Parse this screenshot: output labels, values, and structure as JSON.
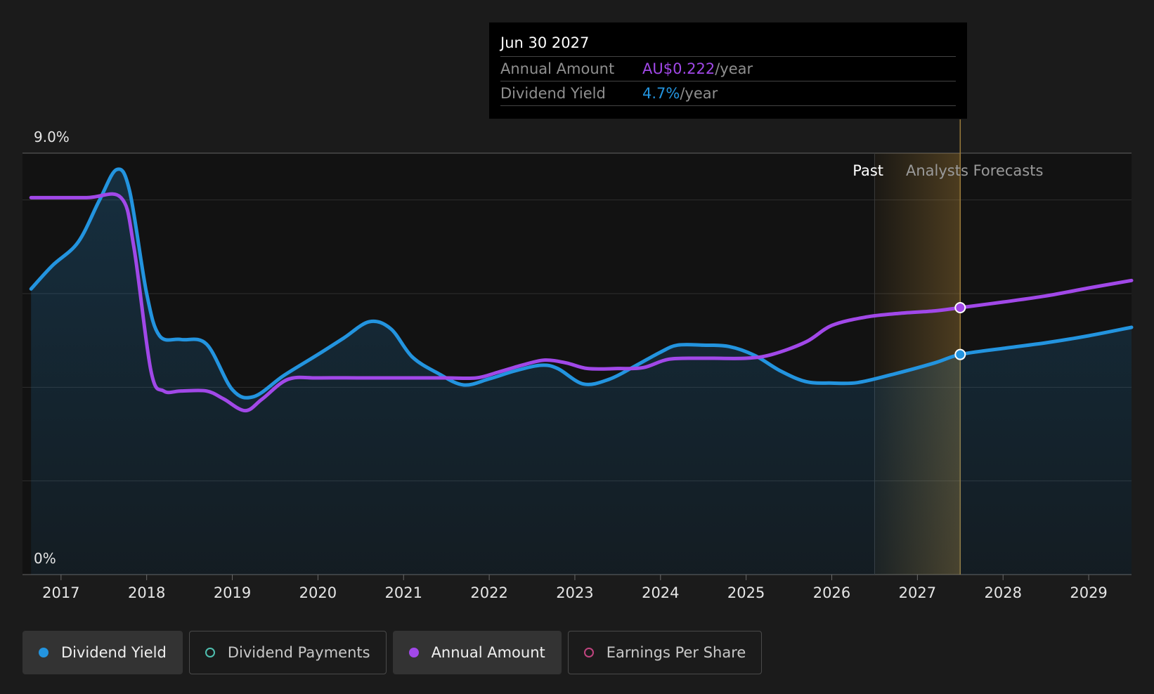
{
  "chart_data": {
    "type": "line",
    "y_tick_labels": {
      "top": "9.0%",
      "bottom": "0%"
    },
    "ylim": [
      0,
      9.0
    ],
    "xlim": [
      2016.55,
      2029.5
    ],
    "x_ticks": [
      "2017",
      "2018",
      "2019",
      "2020",
      "2021",
      "2022",
      "2023",
      "2024",
      "2025",
      "2026",
      "2027",
      "2028",
      "2029"
    ],
    "grid": true,
    "past_label": "Past",
    "forecast_label": "Analysts Forecasts",
    "forecast_start": 2026.5,
    "series": [
      {
        "name": "Dividend Yield",
        "color": "#2394df",
        "area": true,
        "points": [
          [
            2016.65,
            6.1
          ],
          [
            2016.9,
            6.6
          ],
          [
            2017.2,
            7.1
          ],
          [
            2017.45,
            8.0
          ],
          [
            2017.65,
            8.65
          ],
          [
            2017.8,
            8.2
          ],
          [
            2018.0,
            6.0
          ],
          [
            2018.15,
            5.1
          ],
          [
            2018.4,
            5.02
          ],
          [
            2018.7,
            4.92
          ],
          [
            2019.0,
            3.95
          ],
          [
            2019.25,
            3.8
          ],
          [
            2019.6,
            4.25
          ],
          [
            2020.0,
            4.7
          ],
          [
            2020.3,
            5.05
          ],
          [
            2020.6,
            5.4
          ],
          [
            2020.85,
            5.25
          ],
          [
            2021.1,
            4.65
          ],
          [
            2021.4,
            4.3
          ],
          [
            2021.7,
            4.05
          ],
          [
            2022.0,
            4.18
          ],
          [
            2022.3,
            4.35
          ],
          [
            2022.6,
            4.47
          ],
          [
            2022.8,
            4.4
          ],
          [
            2023.1,
            4.07
          ],
          [
            2023.4,
            4.17
          ],
          [
            2023.7,
            4.45
          ],
          [
            2024.0,
            4.75
          ],
          [
            2024.2,
            4.9
          ],
          [
            2024.5,
            4.9
          ],
          [
            2024.8,
            4.87
          ],
          [
            2025.1,
            4.68
          ],
          [
            2025.4,
            4.35
          ],
          [
            2025.7,
            4.12
          ],
          [
            2026.0,
            4.09
          ],
          [
            2026.3,
            4.1
          ],
          [
            2026.7,
            4.27
          ],
          [
            2027.2,
            4.52
          ],
          [
            2027.5,
            4.7
          ],
          [
            2028.0,
            4.83
          ],
          [
            2028.5,
            4.95
          ],
          [
            2029.0,
            5.1
          ],
          [
            2029.5,
            5.28
          ]
        ]
      },
      {
        "name": "Annual Amount",
        "color": "#a148e8",
        "area": false,
        "points": [
          [
            2016.65,
            8.05
          ],
          [
            2017.3,
            8.05
          ],
          [
            2017.7,
            8.05
          ],
          [
            2017.85,
            7.0
          ],
          [
            2018.05,
            4.35
          ],
          [
            2018.2,
            3.92
          ],
          [
            2018.4,
            3.92
          ],
          [
            2018.7,
            3.92
          ],
          [
            2018.9,
            3.75
          ],
          [
            2019.15,
            3.5
          ],
          [
            2019.35,
            3.75
          ],
          [
            2019.65,
            4.17
          ],
          [
            2020.0,
            4.2
          ],
          [
            2020.5,
            4.2
          ],
          [
            2021.0,
            4.2
          ],
          [
            2021.5,
            4.2
          ],
          [
            2021.85,
            4.2
          ],
          [
            2022.1,
            4.32
          ],
          [
            2022.4,
            4.48
          ],
          [
            2022.65,
            4.58
          ],
          [
            2022.9,
            4.52
          ],
          [
            2023.15,
            4.4
          ],
          [
            2023.5,
            4.4
          ],
          [
            2023.8,
            4.42
          ],
          [
            2024.1,
            4.6
          ],
          [
            2024.5,
            4.62
          ],
          [
            2025.0,
            4.62
          ],
          [
            2025.3,
            4.7
          ],
          [
            2025.7,
            4.97
          ],
          [
            2026.0,
            5.32
          ],
          [
            2026.4,
            5.5
          ],
          [
            2026.8,
            5.58
          ],
          [
            2027.2,
            5.63
          ],
          [
            2027.5,
            5.7
          ],
          [
            2028.0,
            5.82
          ],
          [
            2028.5,
            5.95
          ],
          [
            2029.0,
            6.12
          ],
          [
            2029.5,
            6.28
          ]
        ]
      }
    ],
    "highlight_x": 2027.5,
    "highlight_points": [
      {
        "series": "Annual Amount",
        "y": 5.7
      },
      {
        "series": "Dividend Yield",
        "y": 4.7
      }
    ]
  },
  "tooltip": {
    "date": "Jun 30 2027",
    "rows": [
      {
        "label": "Annual Amount",
        "value": "AU$0.222",
        "unit": "/year",
        "color": "#a148e8"
      },
      {
        "label": "Dividend Yield",
        "value": "4.7%",
        "unit": "/year",
        "color": "#2394df"
      }
    ]
  },
  "legend": [
    {
      "label": "Dividend Yield",
      "color": "#2394df",
      "filled": true,
      "active": true
    },
    {
      "label": "Dividend Payments",
      "color": "#4fbfb0",
      "filled": false,
      "active": false
    },
    {
      "label": "Annual Amount",
      "color": "#a148e8",
      "filled": true,
      "active": true
    },
    {
      "label": "Earnings Per Share",
      "color": "#c0447f",
      "filled": false,
      "active": false
    }
  ]
}
